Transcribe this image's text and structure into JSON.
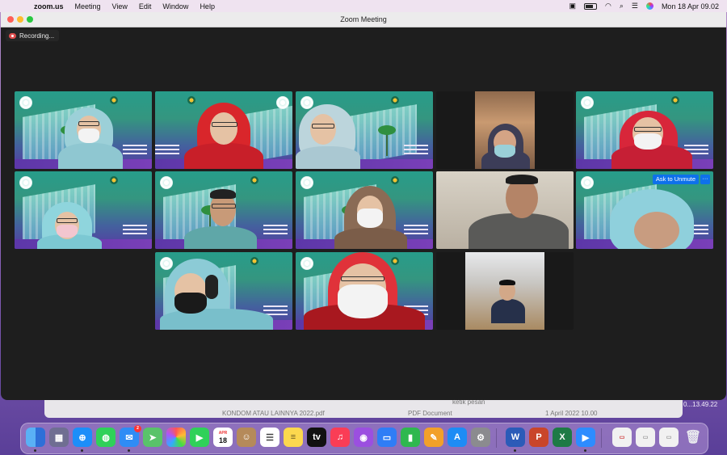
{
  "menubar": {
    "app_name": "zoom.us",
    "items": [
      "Meeting",
      "View",
      "Edit",
      "Window",
      "Help"
    ],
    "clock": "Mon 18 Apr  09.02"
  },
  "window": {
    "title": "Zoom Meeting",
    "recording_label": "Recording..."
  },
  "tile_labels": {
    "ask_to_unmute": "Ask to Unmute",
    "more": "···"
  },
  "background": {
    "text_1": "KONDOM ATAU LAINNYA 2022.pdf",
    "text_2": "PDF Document",
    "text_3": "ketik pesan",
    "text_4": "1 April 2022 10.00",
    "time_fragment": "0...13.49.22"
  },
  "dock": {
    "calendar_month": "APR",
    "calendar_day": "18",
    "mail_badge": "2"
  },
  "colors": {
    "zoom_bg": "#1e1e1e",
    "active_speaker": "#4ad15f",
    "unmute_blue": "#0e71eb",
    "record_red": "#e04d4d"
  }
}
